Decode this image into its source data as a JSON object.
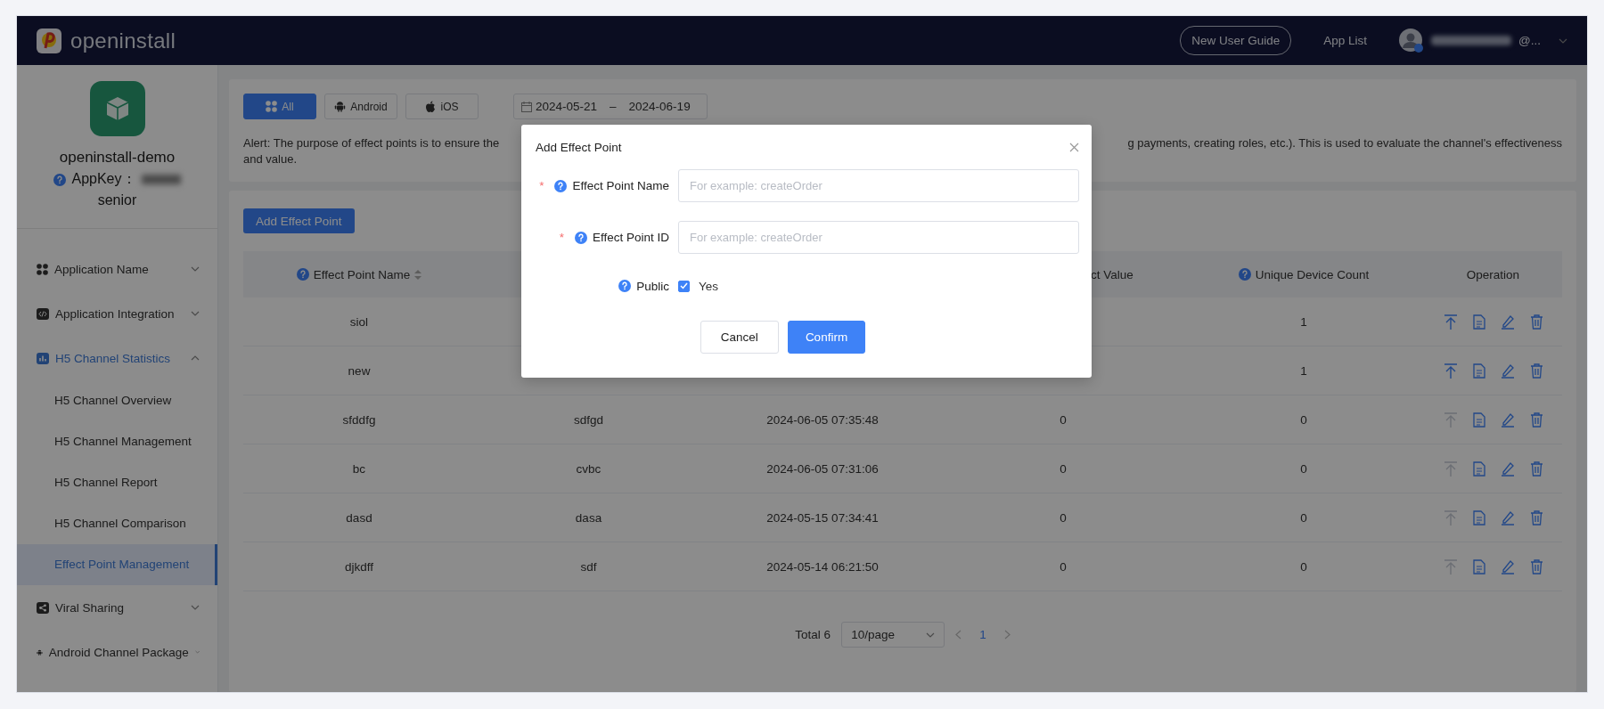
{
  "header": {
    "logo_text": "openinstall",
    "guide_button": "New User Guide",
    "app_list": "App List",
    "account": "@..."
  },
  "sidebar": {
    "app_name": "openinstall-demo",
    "appkey_label": "AppKey：",
    "plan": "senior",
    "menu": [
      {
        "label": "Application Name",
        "expanded": false
      },
      {
        "label": "Application Integration",
        "expanded": false
      },
      {
        "label": "H5 Channel Statistics",
        "expanded": true,
        "children": [
          {
            "label": "H5 Channel Overview",
            "selected": false
          },
          {
            "label": "H5 Channel Management",
            "selected": false
          },
          {
            "label": "H5 Channel Report",
            "selected": false
          },
          {
            "label": "H5 Channel Comparison",
            "selected": false
          },
          {
            "label": "Effect Point Management",
            "selected": true
          }
        ]
      },
      {
        "label": "Viral Sharing",
        "expanded": false
      },
      {
        "label": "Android Channel Package",
        "expanded": false
      }
    ]
  },
  "filter": {
    "platforms": [
      {
        "label": "All",
        "selected": true
      },
      {
        "label": "Android",
        "selected": false
      },
      {
        "label": "iOS",
        "selected": false
      }
    ],
    "date_range": {
      "start": "2024-05-21",
      "separator": "–",
      "end": "2024-06-19"
    },
    "alert_left": "Alert: The purpose of effect points is to ensure the",
    "alert_right": "g payments, creating roles, etc.). This is used to evaluate the channel's effectiveness",
    "alert_line_2": "and value."
  },
  "add_button": "Add Effect Point",
  "table": {
    "columns": [
      {
        "label": "Effect Point Name",
        "help": true,
        "sortable": true
      },
      null,
      null,
      {
        "label": "ct Value",
        "help": false,
        "sortable": false
      },
      {
        "label": "Unique Device Count",
        "help": true,
        "sortable": false
      },
      {
        "label": "Operation",
        "help": false,
        "sortable": false
      }
    ],
    "rows": [
      {
        "cells": [
          "siol",
          null,
          null,
          null,
          "1"
        ],
        "publish_enabled": true
      },
      {
        "cells": [
          "new",
          null,
          null,
          null,
          "1"
        ],
        "publish_enabled": true
      },
      {
        "cells": [
          "sfddfg",
          "sdfgd",
          "2024-06-05 07:35:48",
          "0",
          "0"
        ],
        "publish_enabled": false
      },
      {
        "cells": [
          "bc",
          "cvbc",
          "2024-06-05 07:31:06",
          "0",
          "0"
        ],
        "publish_enabled": false
      },
      {
        "cells": [
          "dasd",
          "dasa",
          "2024-05-15 07:34:41",
          "0",
          "0"
        ],
        "publish_enabled": false
      },
      {
        "cells": [
          "djkdff",
          "sdf",
          "2024-05-14 06:21:50",
          "0",
          "0"
        ],
        "publish_enabled": false
      }
    ]
  },
  "pagination": {
    "total": "Total 6",
    "page_size": "10/page",
    "pages": [
      {
        "label": "1",
        "selected": true
      }
    ]
  },
  "modal": {
    "title": "Add Effect Point",
    "fields": [
      {
        "label": "Effect Point Name",
        "required_mark": "*",
        "placeholder": "For example: createOrder"
      },
      {
        "label": "Effect Point ID",
        "required_mark": "*",
        "placeholder": "For example: createOrder"
      }
    ],
    "public": {
      "label": "Public",
      "option": "Yes",
      "checked": true
    },
    "cancel_button": "Cancel",
    "confirm_button": "Confirm"
  }
}
